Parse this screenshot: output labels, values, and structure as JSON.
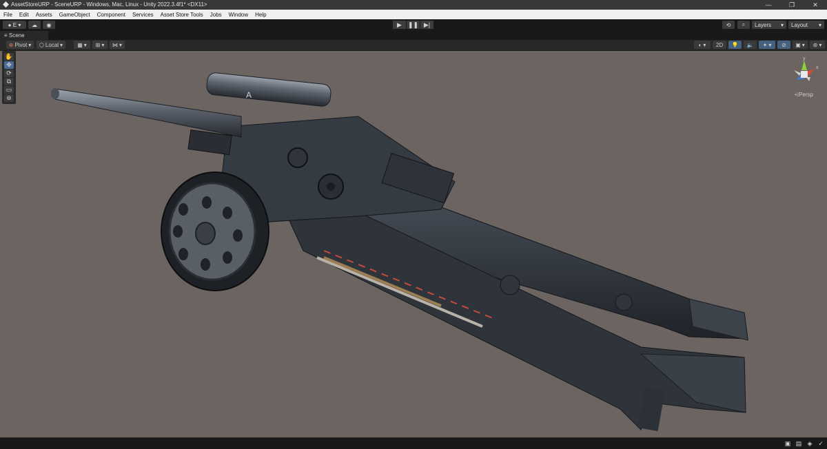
{
  "window": {
    "title": "AssetStoreURP - SceneURP - Windows, Mac, Linux - Unity 2022.3.4f1* <DX11>",
    "minimize": "—",
    "maximize": "❐",
    "close": "✕"
  },
  "menu": [
    "File",
    "Edit",
    "Assets",
    "GameObject",
    "Component",
    "Services",
    "Asset Store Tools",
    "Jobs",
    "Window",
    "Help"
  ],
  "toolbar": {
    "account_label": "E",
    "layers_label": "Layers",
    "layout_label": "Layout"
  },
  "scene_tab": {
    "label": "Scene"
  },
  "scene_toolbar": {
    "pivot_label": "Pivot",
    "local_label": "Local",
    "mode_2d_label": "2D"
  },
  "gizmo": {
    "y_label": "y",
    "x_label": "x",
    "persp_label": "Persp"
  },
  "scene_object": {
    "cradle_letter": "A"
  },
  "colors": {
    "viewport_bg": "#6b6460",
    "accent_blue": "#4a6d96",
    "gizmo_x": "#e0463a",
    "gizmo_y": "#8fcf3e",
    "gizmo_z": "#3f7ee0"
  },
  "icons": {
    "unity_logo": "unity-icon",
    "tools": [
      "hand-icon",
      "move-icon",
      "rotate-icon",
      "scale-icon",
      "rect-icon",
      "transform-icon"
    ]
  }
}
